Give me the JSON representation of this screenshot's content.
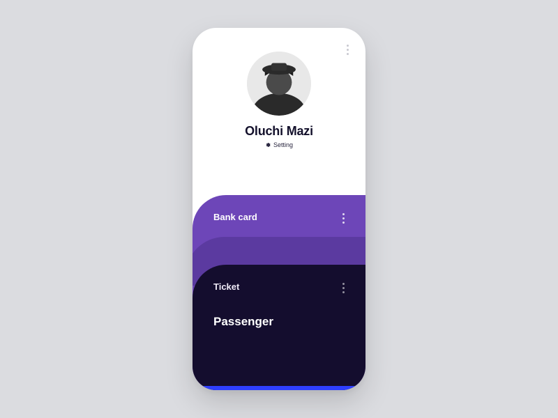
{
  "profile": {
    "name": "Oluchi Mazi",
    "setting_label": "Setting"
  },
  "cards": {
    "bank": {
      "title": "Bank card"
    },
    "ticket": {
      "title": "Ticket",
      "section": "Passenger"
    }
  },
  "colors": {
    "purple": "#6d46b8",
    "dark": "#140d2e",
    "blue": "#2e3fff"
  }
}
